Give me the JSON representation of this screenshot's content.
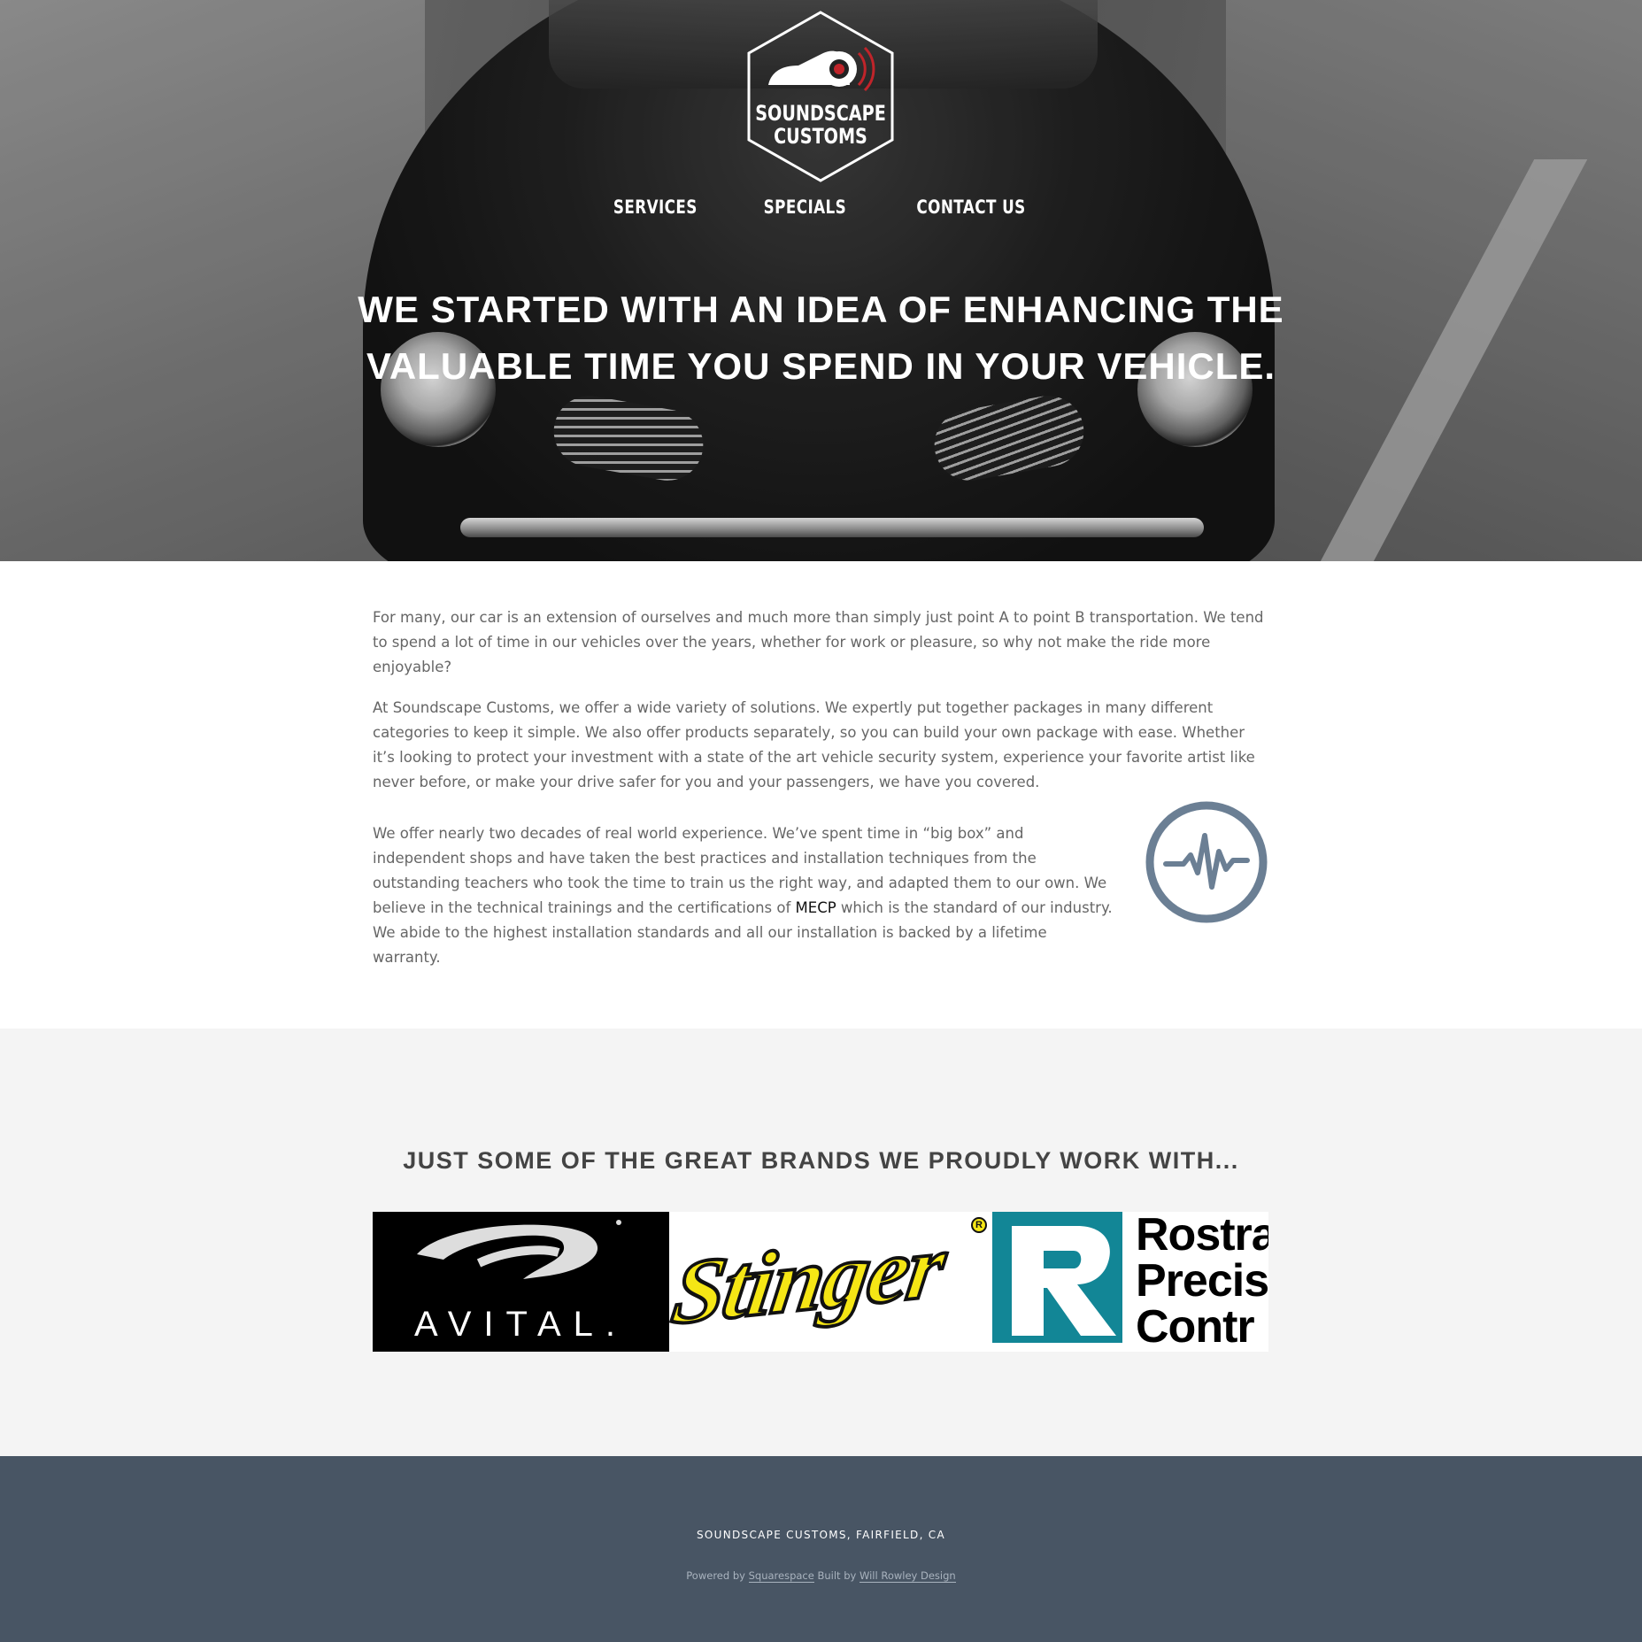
{
  "header": {
    "logo_text_line1": "SOUNDSCAPE",
    "logo_text_line2": "CUSTOMS",
    "nav": [
      {
        "label": "SERVICES"
      },
      {
        "label": "SPECIALS"
      },
      {
        "label": "CONTACT US"
      }
    ]
  },
  "hero": {
    "title_line1": "WE STARTED WITH AN IDEA OF ENHANCING THE",
    "title_line2": "VALUABLE TIME YOU SPEND IN YOUR VEHICLE."
  },
  "about": {
    "p1": "For many, our car is an extension of ourselves and much more than simply just point A to point B transportation. We tend to spend a lot of time in our vehicles over the years, whether for work or pleasure, so why not make the ride more enjoyable?",
    "p2": "At Soundscape Customs, we offer a wide variety of solutions. We expertly put together packages in many different categories to keep it simple. We also offer products separately, so you can build your own package with ease. Whether it’s looking to protect your investment with a state of the art vehicle security system, experience your favorite artist like never before, or make your drive safer for you and your passengers, we have you covered.",
    "p3_before": "We offer nearly two decades of real world experience. We’ve spent time in “big box” and independent shops and have taken the best practices and installation techniques from the outstanding teachers who took the time to train us the right way, and adapted them to our own. We believe in the technical trainings and the certifications of ",
    "p3_link": "MECP",
    "p3_after": " which is the standard of our industry. We abide to the highest installation standards and all our installation is backed by a lifetime warranty.",
    "icon": "pulse-icon",
    "icon_color": "#6b7f94"
  },
  "brands": {
    "heading": "JUST SOME OF THE GREAT BRANDS WE PROUDLY WORK WITH...",
    "logos": [
      {
        "name": "AVITAL",
        "word": "AVITAL."
      },
      {
        "name": "Stinger",
        "word": "Stinger",
        "mark": "R"
      },
      {
        "name": "Rostra",
        "lines": [
          "Rostra",
          "Precis",
          "Contr"
        ]
      }
    ]
  },
  "footer": {
    "address": "SOUNDSCAPE CUSTOMS, FAIRFIELD, CA",
    "powered_by": "Powered by",
    "squarespace": "Squarespace",
    "built_by": "Built by",
    "designer": "Will Rowley Design"
  },
  "colors": {
    "footer_bg": "#485564",
    "brands_bg": "#f4f4f4",
    "stinger_yellow": "#f5e615",
    "rostra_teal": "#128696"
  }
}
